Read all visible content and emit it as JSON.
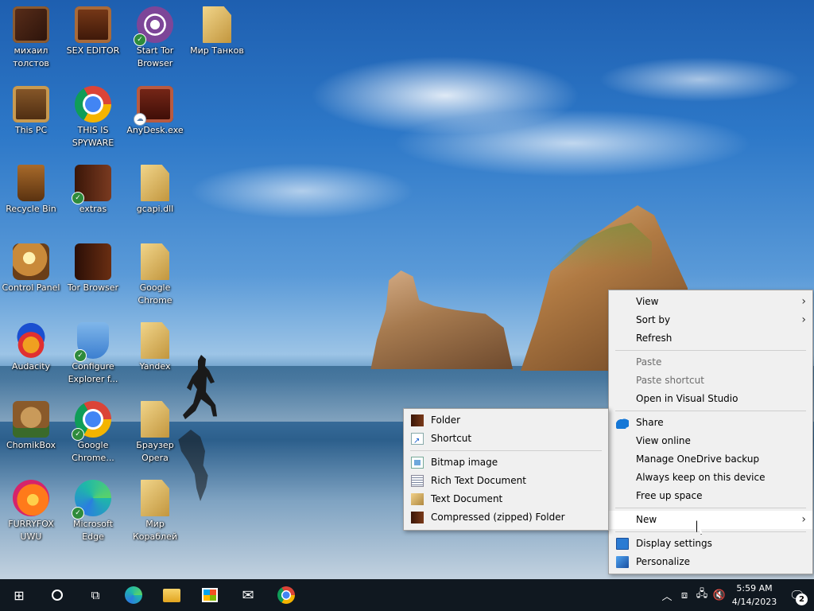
{
  "desktop": {
    "icons": [
      {
        "label": "михаил толстов",
        "icon": "book-icon"
      },
      {
        "label": "SEX EDITOR",
        "icon": "chest-icon"
      },
      {
        "label": "Start Tor Browser",
        "icon": "tor-icon"
      },
      {
        "label": "Мир Танков",
        "icon": "file-icon"
      },
      {
        "label": "This PC",
        "icon": "computer-icon"
      },
      {
        "label": "THIS IS SPYWARE",
        "icon": "chrome-icon"
      },
      {
        "label": "AnyDesk.exe",
        "icon": "anydesk-icon"
      },
      {
        "label": "Recycle Bin",
        "icon": "recycle-bin-icon"
      },
      {
        "label": "extras",
        "icon": "folder-icon"
      },
      {
        "label": "gcapi.dll",
        "icon": "dll-file-icon"
      },
      {
        "label": "Control Panel",
        "icon": "control-panel-icon"
      },
      {
        "label": "Tor Browser",
        "icon": "tor-folder-icon"
      },
      {
        "label": "Google Chrome",
        "icon": "file-icon"
      },
      {
        "label": "Audacity",
        "icon": "audacity-icon"
      },
      {
        "label": "Configure Explorer f...",
        "icon": "shield-icon"
      },
      {
        "label": "Yandex",
        "icon": "file-icon"
      },
      {
        "label": "ChomikBox",
        "icon": "chomikbox-icon"
      },
      {
        "label": "Google Chrome...",
        "icon": "chrome-icon"
      },
      {
        "label": "Браузер Opera",
        "icon": "file-icon"
      },
      {
        "label": "FURRYFOX UWU",
        "icon": "firefox-icon"
      },
      {
        "label": "Microsoft Edge",
        "icon": "edge-icon"
      },
      {
        "label": "Мир Кораблей",
        "icon": "file-icon"
      }
    ]
  },
  "context_menu": {
    "items": [
      {
        "label": "View",
        "type": "submenu"
      },
      {
        "label": "Sort by",
        "type": "submenu"
      },
      {
        "label": "Refresh",
        "type": "item"
      },
      {
        "label": "Paste",
        "type": "disabled"
      },
      {
        "label": "Paste shortcut",
        "type": "disabled"
      },
      {
        "label": "Open in Visual Studio",
        "type": "item"
      },
      {
        "label": "Share",
        "type": "item",
        "icon": "onedrive-cloud-icon"
      },
      {
        "label": "View online",
        "type": "item"
      },
      {
        "label": "Manage OneDrive backup",
        "type": "item"
      },
      {
        "label": "Always keep on this device",
        "type": "item"
      },
      {
        "label": "Free up space",
        "type": "item"
      },
      {
        "label": "New",
        "type": "submenu",
        "state": "highlighted"
      },
      {
        "label": "Display settings",
        "type": "item",
        "icon": "display-icon"
      },
      {
        "label": "Personalize",
        "type": "item",
        "icon": "personalize-icon"
      }
    ]
  },
  "new_submenu": {
    "items": [
      {
        "label": "Folder",
        "icon": "folder-icon"
      },
      {
        "label": "Shortcut",
        "icon": "shortcut-icon"
      },
      {
        "label": "Bitmap image",
        "icon": "bitmap-icon"
      },
      {
        "label": "Rich Text Document",
        "icon": "rich-text-icon"
      },
      {
        "label": "Text Document",
        "icon": "text-document-icon"
      },
      {
        "label": "Compressed (zipped) Folder",
        "icon": "zip-folder-icon"
      }
    ]
  },
  "taskbar": {
    "pinned": [
      "start-icon",
      "search-icon",
      "task-view-icon",
      "edge-icon",
      "file-explorer-icon",
      "store-icon",
      "mail-icon",
      "chrome-icon"
    ],
    "tray": {
      "time": "5:59 AM",
      "date": "4/14/2023",
      "notification_count": "2"
    }
  },
  "colors": {
    "menu_bg": "#f0f0f0",
    "taskbar_bg": "#101820",
    "accent": "#1577d6"
  }
}
